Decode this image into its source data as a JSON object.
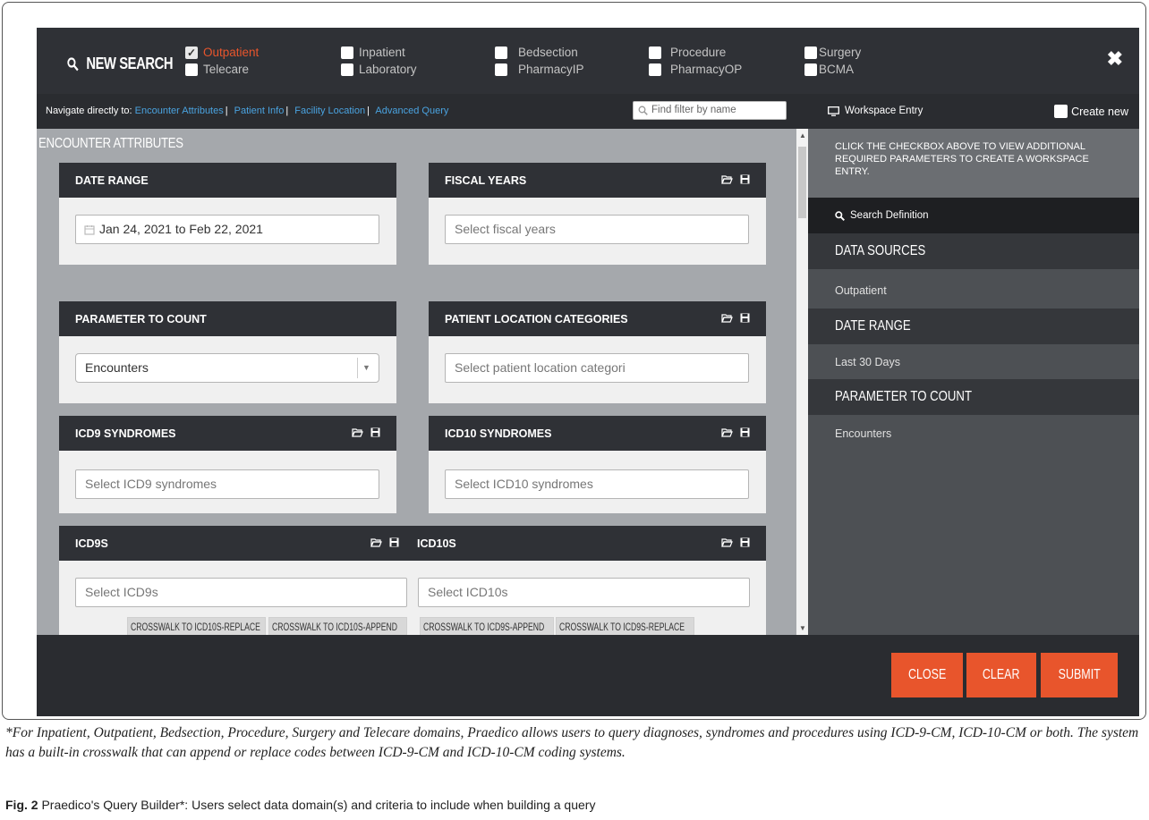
{
  "header": {
    "title": "NEW SEARCH",
    "domains": [
      {
        "label": "Outpatient",
        "checked": true
      },
      {
        "label": "Telecare",
        "checked": false
      },
      {
        "label": "Inpatient",
        "checked": false
      },
      {
        "label": "Laboratory",
        "checked": false
      },
      {
        "label": "Bedsection",
        "checked": false
      },
      {
        "label": "PharmacyIP",
        "checked": false
      },
      {
        "label": "Procedure",
        "checked": false
      },
      {
        "label": "PharmacyOP",
        "checked": false
      },
      {
        "label": "Surgery",
        "checked": false
      },
      {
        "label": "BCMA",
        "checked": false
      }
    ],
    "close_glyph": "✖"
  },
  "nav": {
    "prefix": "Navigate directly to:",
    "links": [
      "Encounter Attributes",
      "Patient Info",
      "Facility Location",
      "Advanced Query"
    ],
    "separator": "|",
    "find_placeholder": "Find filter by name"
  },
  "main": {
    "section_title": "ENCOUNTER ATTRIBUTES",
    "date_range": {
      "title": "DATE RANGE",
      "value": "Jan 24, 2021 to Feb 22, 2021"
    },
    "fiscal_years": {
      "title": "FISCAL YEARS",
      "placeholder": "Select fiscal years"
    },
    "parameter_to_count": {
      "title": "PARAMETER TO COUNT",
      "value": "Encounters"
    },
    "patient_location": {
      "title": "PATIENT LOCATION CATEGORIES",
      "placeholder": "Select patient location categori"
    },
    "icd9_syndromes": {
      "title": "ICD9 SYNDROMES",
      "placeholder": "Select ICD9 syndromes"
    },
    "icd10_syndromes": {
      "title": "ICD10 SYNDROMES",
      "placeholder": "Select ICD10 syndromes"
    },
    "icd9s": {
      "title": "ICD9S",
      "placeholder": "Select ICD9s"
    },
    "icd10s": {
      "title": "ICD10S",
      "placeholder": "Select ICD10s"
    },
    "crosswalk": {
      "to_icd10_replace": "CROSSWALK TO ICD10S-REPLACE",
      "to_icd10_append": "CROSSWALK TO ICD10S-APPEND",
      "to_icd9_append": "CROSSWALK TO ICD9S-APPEND",
      "to_icd9_replace": "CROSSWALK TO ICD9S-REPLACE"
    }
  },
  "right": {
    "workspace_label": "Workspace Entry",
    "create_new_label": "Create new",
    "message": "CLICK THE CHECKBOX ABOVE TO VIEW ADDITIONAL REQUIRED PARAMETERS TO CREATE A WORKSPACE ENTRY.",
    "search_definition_label": "Search Definition",
    "sections": [
      {
        "title": "DATA SOURCES",
        "value": "Outpatient"
      },
      {
        "title": "DATE RANGE",
        "value": "Last 30 Days"
      },
      {
        "title": "PARAMETER TO COUNT",
        "value": "Encounters"
      }
    ]
  },
  "footer": {
    "close": "CLOSE",
    "clear": "CLEAR",
    "submit": "SUBMIT"
  },
  "caption": {
    "note": "*For Inpatient, Outpatient, Bedsection, Procedure, Surgery and Telecare domains, Praedico allows users to query diagnoses, syndromes and procedures using ICD-9-CM, ICD-10-CM or both. The system has a built-in crosswalk that can append or replace codes between ICD-9-CM and ICD-10-CM coding systems.",
    "fig_label": "Fig. 2",
    "fig_text": "Praedico's Query Builder*: Users select data domain(s) and criteria to include when building a query"
  },
  "colors": {
    "accent": "#e8552c",
    "link": "#4aa3e0",
    "dark": "#2f3136",
    "panel": "#4d5054"
  }
}
